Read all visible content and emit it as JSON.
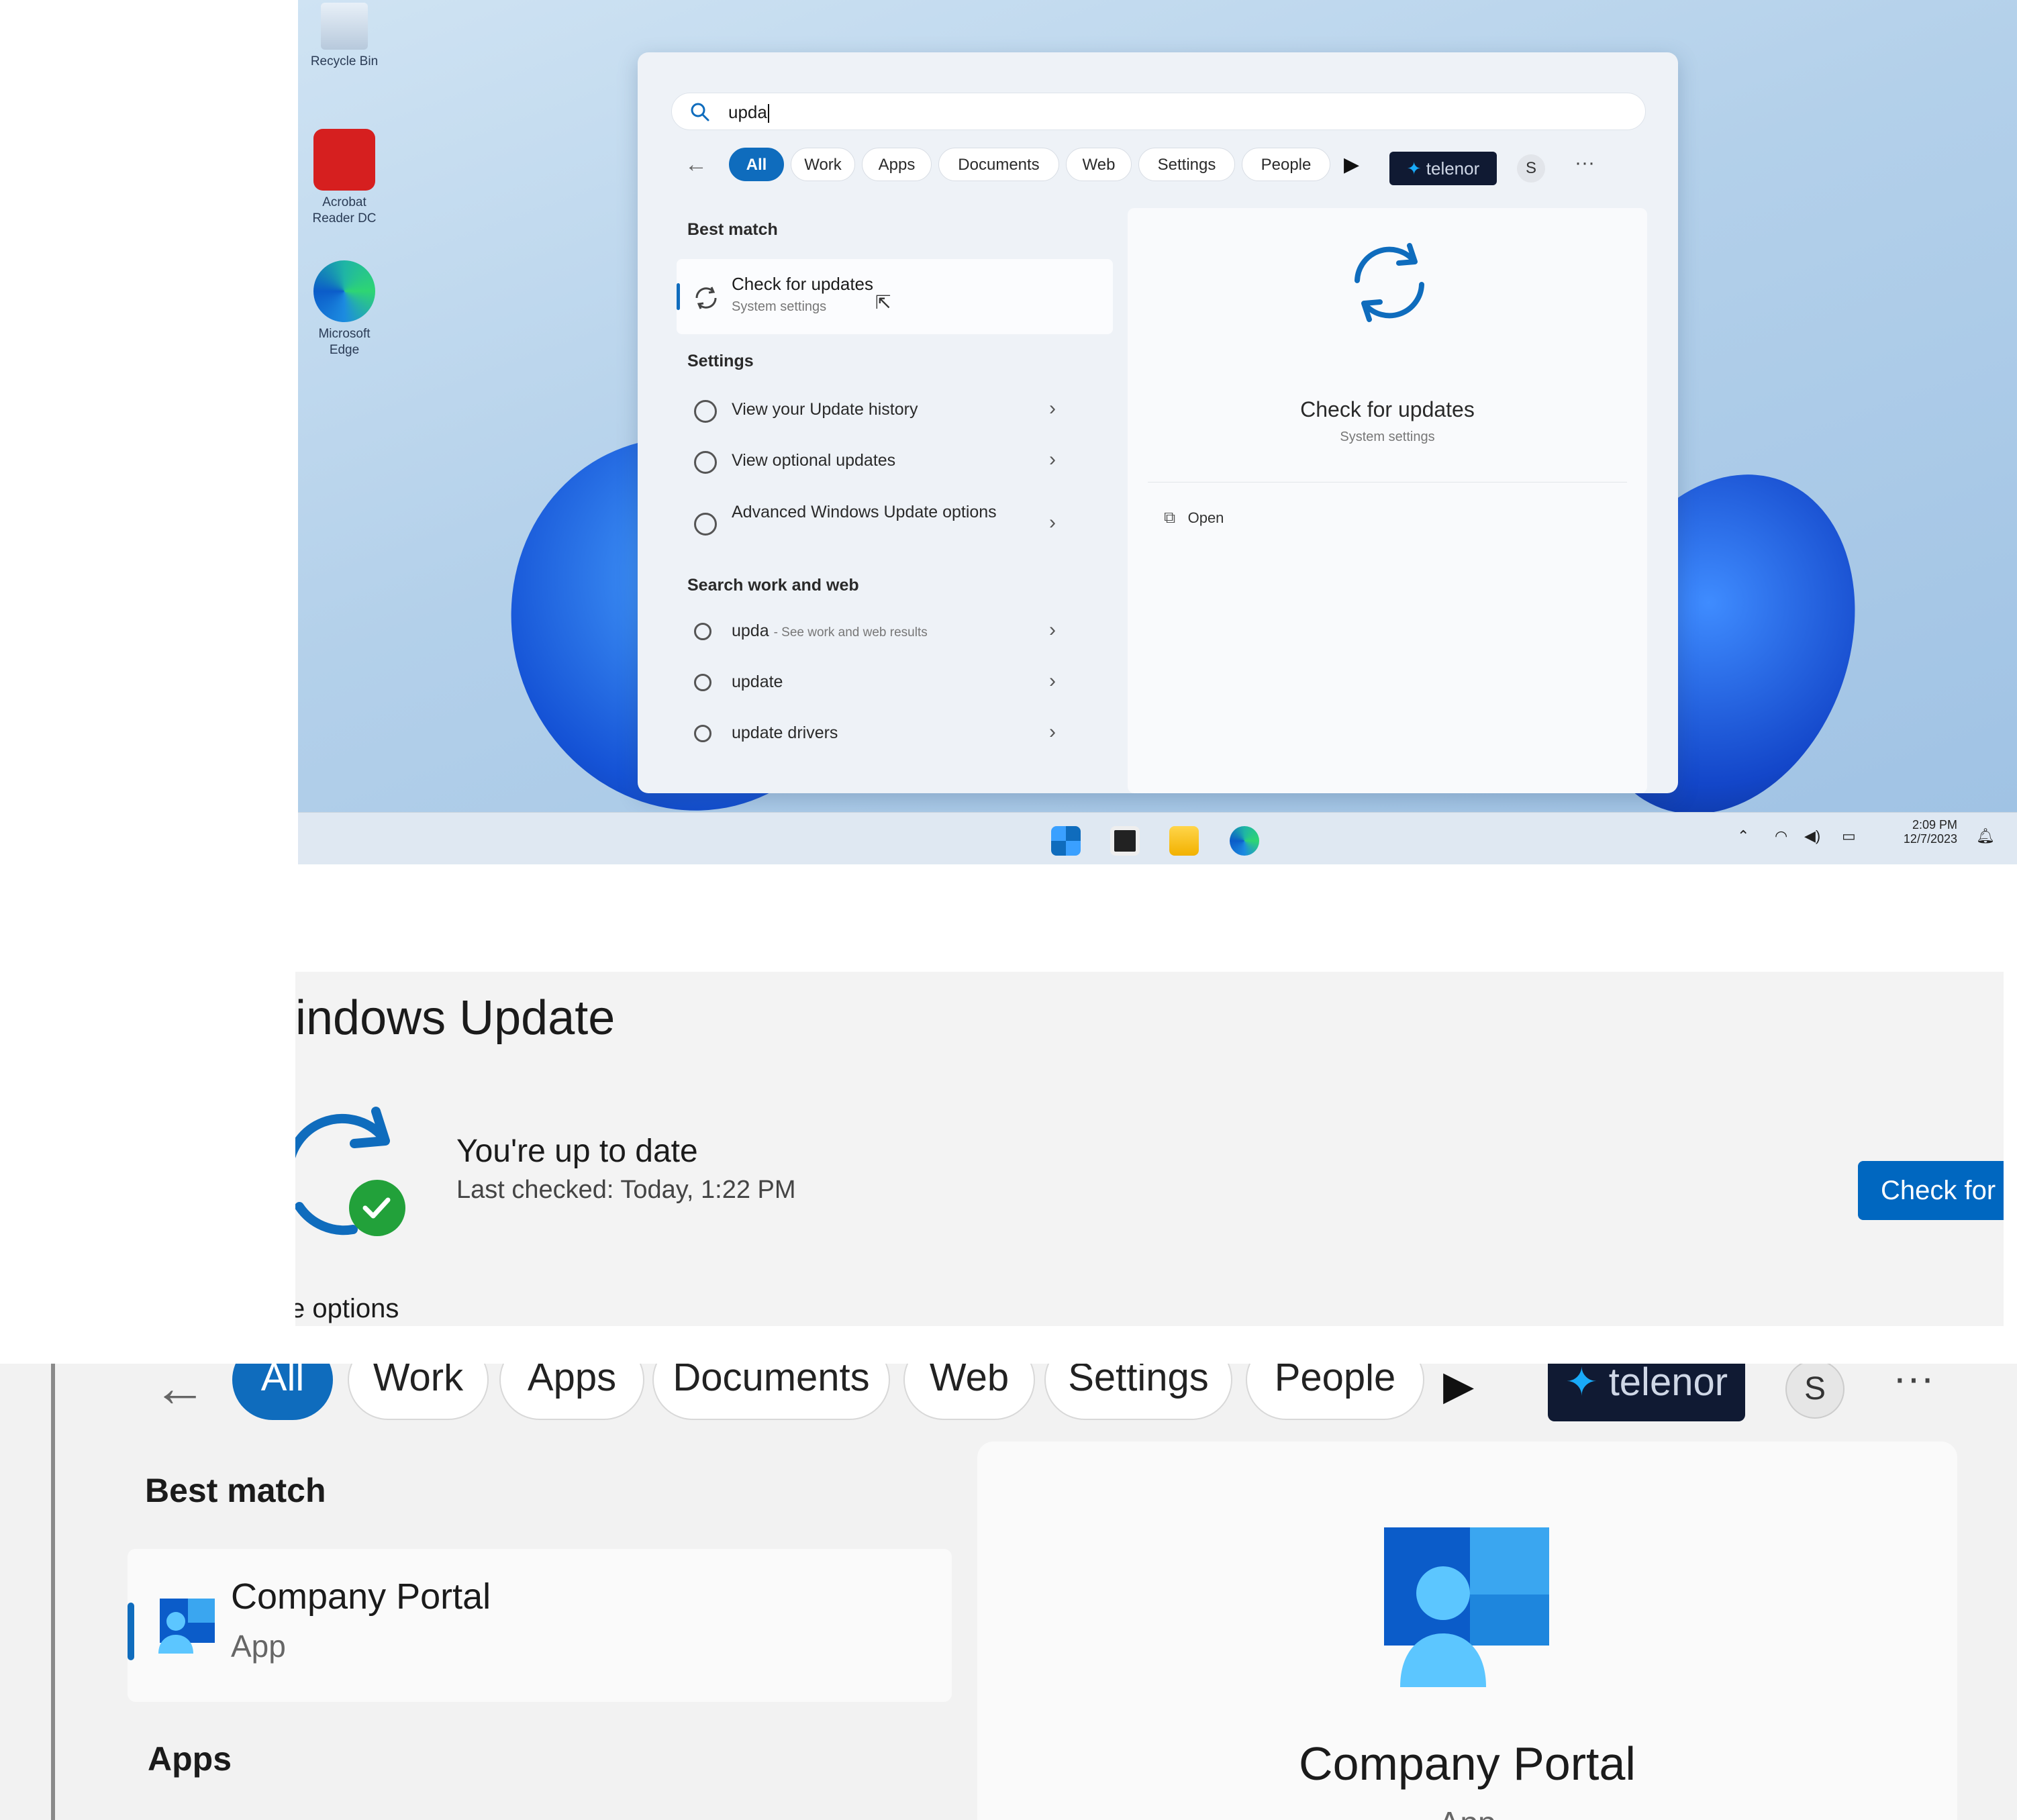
{
  "desktop": {
    "icons": [
      {
        "label": "Recycle Bin",
        "icon": "recycle-bin-icon"
      },
      {
        "label": "Acrobat Reader DC",
        "icon": "acrobat-icon"
      },
      {
        "label": "Microsoft Edge",
        "icon": "edge-icon"
      }
    ]
  },
  "search": {
    "query": "upda",
    "filters": [
      "All",
      "Work",
      "Apps",
      "Documents",
      "Web",
      "Settings",
      "People"
    ],
    "org_badge": "telenor",
    "avatar_initial": "S",
    "more": "···",
    "best_match_heading": "Best match",
    "best_match": {
      "title": "Check for updates",
      "subtitle": "System settings"
    },
    "settings_heading": "Settings",
    "settings_items": [
      "View your Update history",
      "View optional updates",
      "Advanced Windows Update options"
    ],
    "web_heading": "Search work and web",
    "web_items": [
      {
        "label": "upda",
        "hint": "- See work and web results"
      },
      {
        "label": "update",
        "hint": ""
      },
      {
        "label": "update drivers",
        "hint": ""
      }
    ],
    "preview": {
      "title": "Check for updates",
      "subtitle": "System settings",
      "action": "Open"
    }
  },
  "taskbar": {
    "time": "2:09 PM",
    "date": "12/7/2023"
  },
  "update": {
    "title": "indows Update",
    "status": "You're up to date",
    "last_checked": "Last checked: Today, 1:22 PM",
    "button": "Check for u",
    "more_options": "e options"
  },
  "zoom": {
    "filters": [
      "All",
      "Work",
      "Apps",
      "Documents",
      "Web",
      "Settings",
      "People"
    ],
    "org_badge": "telenor",
    "avatar_initial": "S",
    "more": "···",
    "best_match_heading": "Best match",
    "best_match": {
      "title": "Company Portal",
      "subtitle": "App"
    },
    "apps_heading": "Apps",
    "preview": {
      "title": "Company Portal",
      "subtitle": "App"
    }
  },
  "colors": {
    "accent": "#0f6cbd",
    "button": "#0067c0",
    "success": "#22a13a"
  }
}
